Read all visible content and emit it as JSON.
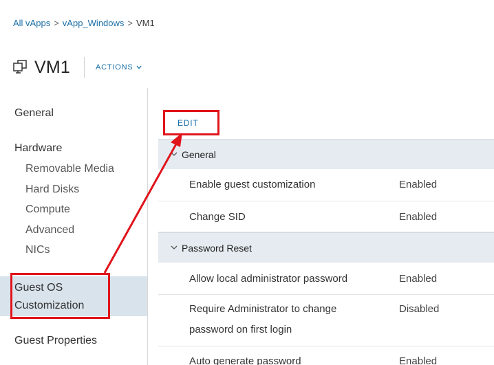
{
  "breadcrumb": {
    "items": [
      "All vApps",
      "vApp_Windows",
      "VM1"
    ],
    "separator": ">"
  },
  "header": {
    "title": "VM1",
    "actions_label": "ACTIONS"
  },
  "sidebar": {
    "general": "General",
    "hardware": "Hardware",
    "hardware_items": [
      "Removable Media",
      "Hard Disks",
      "Compute",
      "Advanced",
      "NICs"
    ],
    "guest_os_line1": "Guest OS",
    "guest_os_line2": "Customization",
    "guest_properties": "Guest Properties",
    "active_item": "Guest OS Customization"
  },
  "main": {
    "edit_label": "EDIT",
    "sections": [
      {
        "title": "General",
        "rows": [
          {
            "label": "Enable guest customization",
            "value": "Enabled"
          },
          {
            "label": "Change SID",
            "value": "Enabled"
          }
        ]
      },
      {
        "title": "Password Reset",
        "rows": [
          {
            "label": "Allow local administrator password",
            "value": "Enabled"
          },
          {
            "label_line1": "Require Administrator to change",
            "label_line2": "password on first login",
            "value": "Disabled"
          },
          {
            "label": "Auto generate password",
            "value": "Enabled"
          }
        ]
      }
    ]
  },
  "colors": {
    "link": "#1a6fa8",
    "active_nav": "#d9e3ec",
    "section_header": "#e5ebf0",
    "annotation": "#e0141b"
  }
}
